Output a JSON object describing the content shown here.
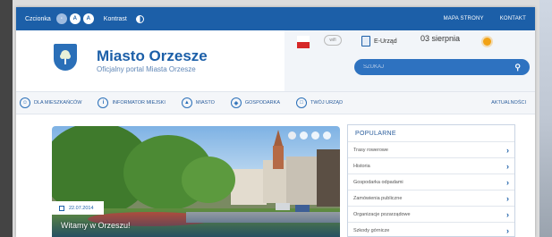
{
  "topbar": {
    "font_size_label": "Czcionka",
    "font_buttons": [
      "-",
      "A",
      "A"
    ],
    "contrast_label": "Kontrast",
    "links": [
      "MAPA STRONY",
      "KONTAKT"
    ]
  },
  "header": {
    "title": "Miasto Orzesze",
    "subtitle": "Oficjalny portal Miasta Orzesze",
    "eu_label": "E-Urząd",
    "date": "03 sierpnia",
    "search_placeholder": "SZUKAJ"
  },
  "nav": {
    "items": [
      {
        "label": "DLA MIESZKAŃCÓW",
        "icon": "people-icon"
      },
      {
        "label": "INFORMATOR MIEJSKI",
        "icon": "info-icon"
      },
      {
        "label": "MIASTO",
        "icon": "city-icon"
      },
      {
        "label": "GOSPODARKA",
        "icon": "business-icon"
      },
      {
        "label": "TWÓJ URZĄD",
        "icon": "office-icon"
      }
    ],
    "plain_item": "AKTUALNOŚCI"
  },
  "hero": {
    "date": "22.07.2014",
    "title": "Witamy w Orzeszu!"
  },
  "popular": {
    "heading": "POPULARNE",
    "items": [
      "Trasy rowerowe",
      "Historia",
      "Gospodarka odpadami",
      "Zamówienia publiczne",
      "Organizacje pozarządowe",
      "Szkody górnicze"
    ]
  },
  "colors": {
    "brand_blue": "#1c5fa8",
    "accent_orange": "#f2a215"
  }
}
